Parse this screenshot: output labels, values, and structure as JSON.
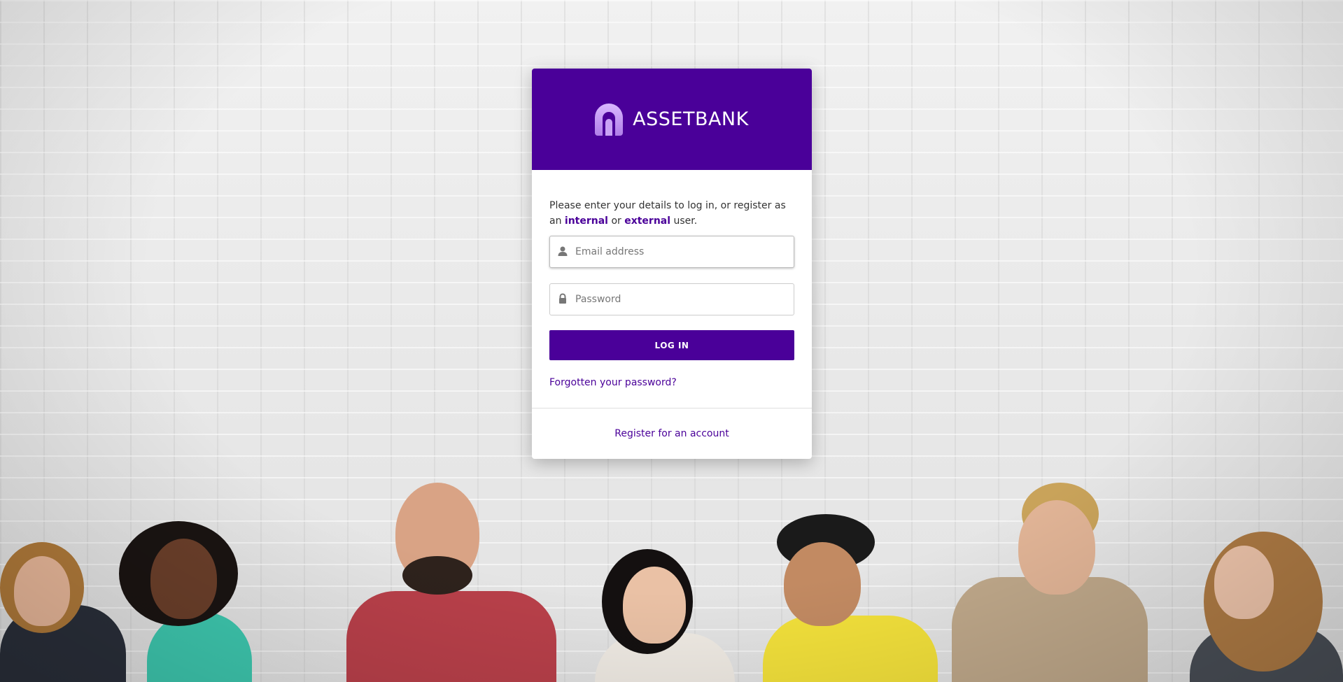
{
  "brand": {
    "name": "ASSETBANK",
    "primary_color": "#4a0099"
  },
  "login": {
    "intro_prefix": "Please enter your details to log in, or register as an",
    "internal_link": "internal",
    "intro_or": "or",
    "external_link": "external",
    "intro_suffix": "user.",
    "email": {
      "placeholder": "Email address",
      "value": "",
      "icon": "user-icon"
    },
    "password": {
      "placeholder": "Password",
      "value": "",
      "icon": "lock-icon"
    },
    "submit_label": "LOG IN",
    "forgot_label": "Forgotten your password?",
    "register_label": "Register for an account"
  }
}
